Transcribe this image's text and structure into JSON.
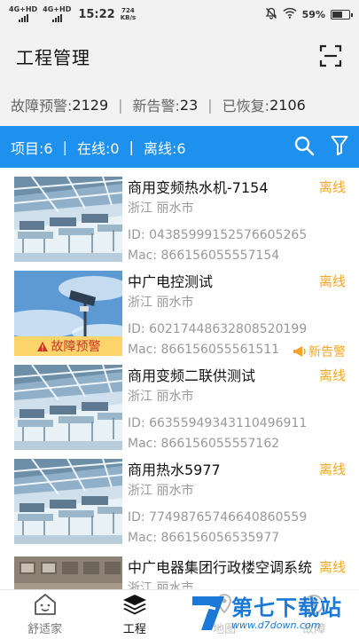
{
  "status_bar": {
    "net1": "4G+HD",
    "net2": "4G+HD",
    "time": "15:22",
    "speed_value": "724",
    "speed_unit": "KB/s",
    "battery": "59%",
    "battery_level": 0.59
  },
  "header": {
    "title": "工程管理",
    "scan_icon": "scan-icon"
  },
  "summary": {
    "fault_label": "故障预警:",
    "fault_count": "2129",
    "new_label": "新告警:",
    "new_count": "23",
    "recovered_label": "已恢复:",
    "recovered_count": "2106",
    "separator": "|"
  },
  "filter_bar": {
    "projects": "项目:6",
    "online": "在线:0",
    "offline": "离线:6",
    "separator": "|",
    "search_icon": "search-icon",
    "filter_icon": "filter-icon"
  },
  "projects": [
    {
      "name": "商用变频热水机-7154",
      "status": "离线",
      "location": "浙江 丽水市",
      "id": "ID: 04385999152576605265",
      "mac": "Mac: 866156055557154",
      "fault_tag": "",
      "alert": "",
      "thumb": "factory"
    },
    {
      "name": "中广电控测试",
      "status": "离线",
      "location": "浙江 丽水市",
      "id": "ID: 60217448632808520199",
      "mac": "Mac: 866156055561511",
      "fault_tag": "故障预警",
      "alert": "新告警",
      "thumb": "sky"
    },
    {
      "name": "商用变频二联供测试",
      "status": "离线",
      "location": "浙江 丽水市",
      "id": "ID: 66355949343110496911",
      "mac": "Mac: 866156055557162",
      "fault_tag": "",
      "alert": "",
      "thumb": "factory"
    },
    {
      "name": "商用热水5977",
      "status": "离线",
      "location": "浙江 丽水市",
      "id": "ID: 77498765746640860559",
      "mac": "Mac: 866156056535977",
      "fault_tag": "",
      "alert": "",
      "thumb": "factory"
    },
    {
      "name": "中广电器集团行政楼空调系统",
      "status": "离线",
      "location": "浙江 丽水市",
      "id": "",
      "mac": "",
      "fault_tag": "",
      "alert": "",
      "thumb": "building"
    }
  ],
  "tabbar": {
    "tabs": [
      {
        "label": "舒适家",
        "icon": "home-face-icon",
        "active": false
      },
      {
        "label": "工程",
        "icon": "layers-icon",
        "active": true
      },
      {
        "label": "地图",
        "icon": "map-icon",
        "active": false
      },
      {
        "label": "故障",
        "icon": "fault-icon",
        "active": false
      }
    ]
  },
  "watermark": {
    "title": "第七下载站",
    "url": "www.d7down.com"
  },
  "colors": {
    "accent": "#1e90ee",
    "status_offline": "#f6a623",
    "fault_tag_bg": "#fbd46a",
    "fault_tag_text": "#d0302a"
  }
}
